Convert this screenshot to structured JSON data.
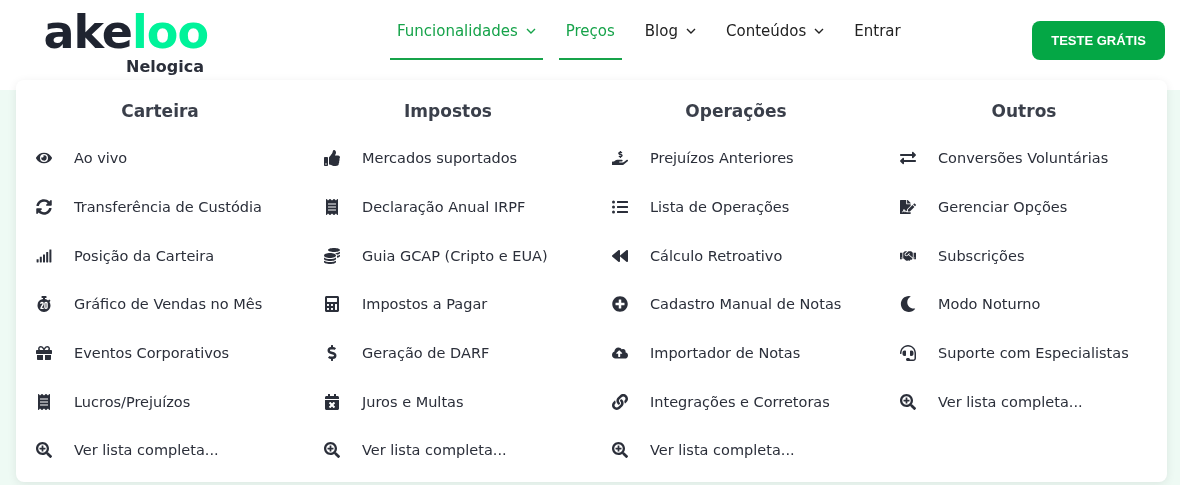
{
  "logo": {
    "text": "ake",
    "accent": "loo",
    "subtitle": "Nelogica"
  },
  "nav": [
    {
      "label": "Funcionalidades",
      "selected": true,
      "dropdown": true
    },
    {
      "label": "Preços",
      "selected": true,
      "dropdown": false
    },
    {
      "label": "Blog",
      "selected": false,
      "dropdown": true
    },
    {
      "label": "Conteúdos",
      "selected": false,
      "dropdown": true
    },
    {
      "label": "Entrar",
      "selected": false,
      "dropdown": false
    }
  ],
  "cta": "TESTE GRÁTIS",
  "menu": [
    {
      "title": "Carteira",
      "items": [
        "Ao vivo",
        "Transferência de Custódia",
        "Posição da Carteira",
        "Gráfico de Vendas no Mês",
        "Eventos Corporativos",
        "Lucros/Prejuízos",
        "Ver lista completa..."
      ]
    },
    {
      "title": "Impostos",
      "items": [
        "Mercados suportados",
        "Declaração Anual IRPF",
        "Guia GCAP (Cripto e EUA)",
        "Impostos a Pagar",
        "Geração de DARF",
        "Juros e Multas",
        "Ver lista completa..."
      ]
    },
    {
      "title": "Operações",
      "items": [
        "Prejuízos Anteriores",
        "Lista de Operações",
        "Cálculo Retroativo",
        "Cadastro Manual de Notas",
        "Importador de Notas",
        "Integrações e Corretoras",
        "Ver lista completa..."
      ]
    },
    {
      "title": "Outros",
      "items": [
        "Conversões Voluntárias",
        "Gerenciar Opções",
        "Subscrições",
        "Modo Noturno",
        "Suporte com Especialistas",
        "Ver lista completa..."
      ]
    }
  ]
}
